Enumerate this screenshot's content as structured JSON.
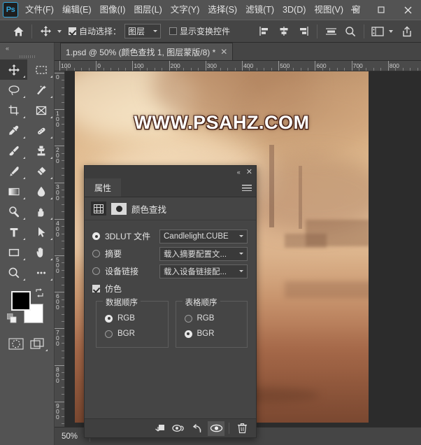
{
  "app": {
    "logo_text": "Ps",
    "menus": [
      {
        "label": "文件(F)",
        "name": "menu-file"
      },
      {
        "label": "编辑(E)",
        "name": "menu-edit"
      },
      {
        "label": "图像(I)",
        "name": "menu-image"
      },
      {
        "label": "图层(L)",
        "name": "menu-layer"
      },
      {
        "label": "文字(Y)",
        "name": "menu-type"
      },
      {
        "label": "选择(S)",
        "name": "menu-select"
      },
      {
        "label": "滤镜(T)",
        "name": "menu-filter"
      },
      {
        "label": "3D(D)",
        "name": "menu-3d"
      },
      {
        "label": "视图(V)",
        "name": "menu-view"
      },
      {
        "label": "窗",
        "name": "menu-window"
      }
    ],
    "window_controls": {
      "minimize": "–",
      "maximize": "□",
      "close": "✕"
    }
  },
  "options_bar": {
    "home_icon": "home-icon",
    "move_tool_icon": "move-tool-icon",
    "auto_select_checked": true,
    "auto_select_label": "自动选择：",
    "target_value": "图层",
    "show_transform_checked": false,
    "show_transform_label": "显示变换控件",
    "align_left_icon": "align-left-icon",
    "align_center_icon": "align-center-vertical-icon",
    "align_right_icon": "align-right-icon",
    "distribute_icon": "distribute-icon",
    "search_icon": "search-icon",
    "arrange_icon": "arrange-documents-icon",
    "share_icon": "share-icon"
  },
  "tab_bar": {
    "collapse_icon": "collapse-left-icon",
    "document": {
      "title": "1.psd @ 50% (颜色查找 1, 图层蒙版/8) *",
      "close": "✕"
    }
  },
  "toolbar": {
    "collapse_label": "«",
    "tools": [
      {
        "name": "move-tool",
        "icon": "move-tool-icon",
        "selected": true
      },
      {
        "name": "marquee-tool",
        "icon": "rectangular-marquee-icon",
        "selected": false
      },
      {
        "name": "lasso-tool",
        "icon": "lasso-icon",
        "selected": false
      },
      {
        "name": "magic-wand-tool",
        "icon": "magic-wand-icon",
        "selected": false
      },
      {
        "name": "crop-tool",
        "icon": "crop-icon",
        "selected": false
      },
      {
        "name": "frame-tool",
        "icon": "frame-icon",
        "selected": false
      },
      {
        "name": "eyedropper-tool",
        "icon": "eyedropper-icon",
        "selected": false
      },
      {
        "name": "healing-brush-tool",
        "icon": "healing-brush-icon",
        "selected": false
      },
      {
        "name": "brush-tool",
        "icon": "brush-icon",
        "selected": false
      },
      {
        "name": "clone-stamp-tool",
        "icon": "clone-stamp-icon",
        "selected": false
      },
      {
        "name": "history-brush-tool",
        "icon": "history-brush-icon",
        "selected": false
      },
      {
        "name": "eraser-tool",
        "icon": "eraser-icon",
        "selected": false
      },
      {
        "name": "gradient-tool",
        "icon": "gradient-icon",
        "selected": false
      },
      {
        "name": "blur-tool",
        "icon": "blur-droplet-icon",
        "selected": false
      },
      {
        "name": "dodge-tool",
        "icon": "dodge-icon",
        "selected": false
      },
      {
        "name": "burn-tool",
        "icon": "burn-hand-icon",
        "selected": false
      },
      {
        "name": "type-tool",
        "icon": "type-t-icon",
        "selected": false
      },
      {
        "name": "path-selection-tool",
        "icon": "path-arrow-icon",
        "selected": false
      },
      {
        "name": "rectangle-tool",
        "icon": "rectangle-shape-icon",
        "selected": false
      },
      {
        "name": "hand-tool",
        "icon": "hand-icon",
        "selected": false
      },
      {
        "name": "zoom-tool",
        "icon": "zoom-magnifier-icon",
        "selected": false
      },
      {
        "name": "edit-toolbar",
        "icon": "ellipsis-icon",
        "selected": false
      }
    ],
    "foreground_color": "#000000",
    "background_color": "#ffffff",
    "swap_icon": "swap-colors-icon",
    "default_icon": "default-colors-icon",
    "quick_mask_icon": "quick-mask-icon",
    "screen_mode_icon": "screen-mode-icon"
  },
  "rulers": {
    "horizontal_labels": [
      "100",
      "0",
      "100",
      "200",
      "300",
      "400",
      "500",
      "600",
      "700",
      "800"
    ],
    "vertical_labels": [
      "0",
      "100",
      "200",
      "300",
      "400",
      "500",
      "600",
      "700",
      "800",
      "900"
    ],
    "unit": "px"
  },
  "canvas": {
    "watermark": "WWW.PSAHZ.COM",
    "scene_description": "desert-mech-sepia"
  },
  "status_bar": {
    "zoom": "50%"
  },
  "properties_panel": {
    "collapse_icon": "«",
    "close_icon": "✕",
    "tab_label": "属性",
    "menu_icon": "panel-menu-icon",
    "adjustment_icon": "color-lookup-grid-icon",
    "mask_icon": "layer-mask-thumbnail-icon",
    "title": "颜色查找",
    "rows": [
      {
        "name": "3dlut-file",
        "label": "3DLUT 文件",
        "selected": true,
        "value": "Candlelight.CUBE"
      },
      {
        "name": "abstract",
        "label": "摘要",
        "selected": false,
        "value": "载入摘要配置文..."
      },
      {
        "name": "device-link",
        "label": "设备链接",
        "selected": false,
        "value": "载入设备链接配..."
      }
    ],
    "dither": {
      "label": "仿色",
      "checked": true
    },
    "fieldsets": [
      {
        "name": "data-order",
        "legend": "数据顺序",
        "options": [
          {
            "label": "RGB",
            "selected": true
          },
          {
            "label": "BGR",
            "selected": false
          }
        ]
      },
      {
        "name": "table-order",
        "legend": "表格顺序",
        "options": [
          {
            "label": "RGB",
            "selected": false
          },
          {
            "label": "BGR",
            "selected": true
          }
        ]
      }
    ],
    "footer_buttons": [
      {
        "name": "clip-to-layer-button",
        "icon": "clip-to-layer-icon",
        "active": false
      },
      {
        "name": "view-previous-state-button",
        "icon": "view-previous-state-icon",
        "active": false
      },
      {
        "name": "reset-button",
        "icon": "reset-arrow-icon",
        "active": false
      },
      {
        "name": "toggle-visibility-button",
        "icon": "eye-icon",
        "active": true
      },
      {
        "name": "delete-button",
        "icon": "trash-icon",
        "active": false
      }
    ]
  }
}
